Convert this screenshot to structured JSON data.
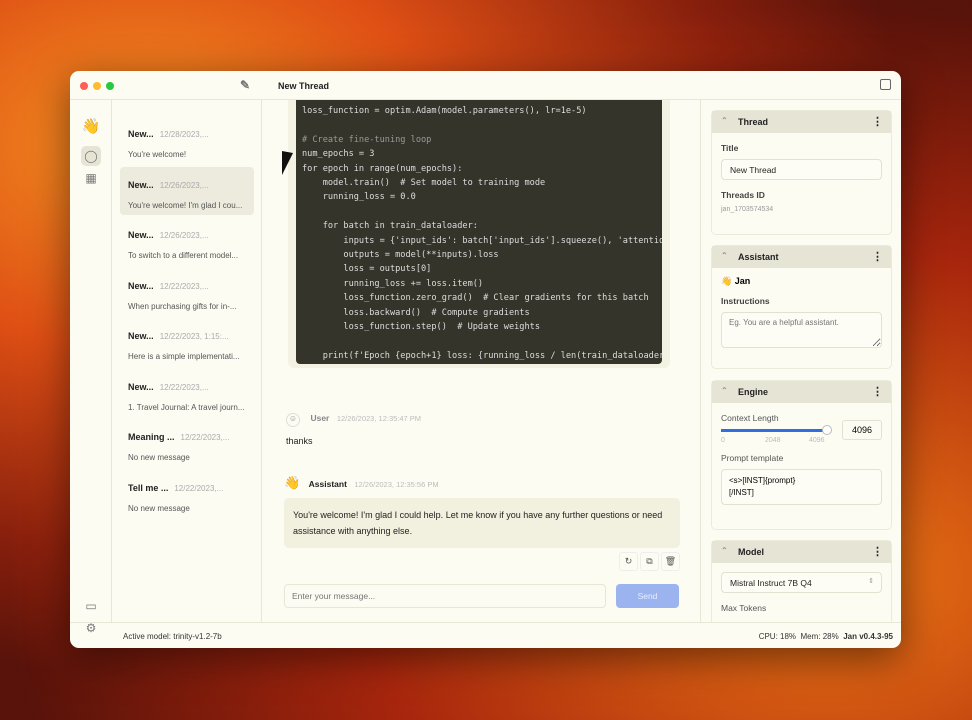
{
  "window": {
    "title": "New Thread"
  },
  "threads": [
    {
      "name": "New...",
      "date": "12/28/2023,...",
      "msg": "You're welcome!"
    },
    {
      "name": "New...",
      "date": "12/26/2023,...",
      "msg": "You're welcome! I'm glad I cou..."
    },
    {
      "name": "New...",
      "date": "12/26/2023,...",
      "msg": "To switch to a different model..."
    },
    {
      "name": "New...",
      "date": "12/22/2023,...",
      "msg": "When purchasing gifts for in-..."
    },
    {
      "name": "New...",
      "date": "12/22/2023, 1:15:...",
      "msg": "Here is a simple implementati..."
    },
    {
      "name": "New...",
      "date": "12/22/2023,...",
      "msg": "1. Travel Journal: A travel journ..."
    },
    {
      "name": "Meaning ...",
      "date": "12/22/2023,...",
      "msg": "No new message"
    },
    {
      "name": "Tell me ...",
      "date": "12/22/2023,...",
      "msg": "No new message"
    }
  ],
  "code": [
    "loss_function = optim.Adam(model.parameters(), lr=1e-5)",
    "",
    "# Create fine-tuning loop",
    "num_epochs = 3",
    "for epoch in range(num_epochs):",
    "    model.train()  # Set model to training mode",
    "    running_loss = 0.0",
    "",
    "    for batch in train_dataloader:",
    "        inputs = {'input_ids': batch['input_ids'].squeeze(), 'attention",
    "        outputs = model(**inputs).loss",
    "        loss = outputs[0]",
    "        running_loss += loss.item()",
    "        loss_function.zero_grad()  # Clear gradients for this batch",
    "        loss.backward()  # Compute gradients",
    "        loss_function.step()  # Update weights",
    "",
    "    print(f'Epoch {epoch+1} loss: {running_loss / len(train_dataloader"
  ],
  "messages": [
    {
      "author": "User",
      "time": "12/26/2023, 12:35:47 PM",
      "text": "thanks"
    },
    {
      "author": "Assistant",
      "time": "12/26/2023, 12:35:56 PM",
      "text": "You're welcome! I'm glad I could help. Let me know if you have any further questions or need assistance with anything else."
    }
  ],
  "composer": {
    "placeholder": "Enter your message...",
    "send": "Send"
  },
  "panel": {
    "thread": {
      "header": "Thread",
      "title_label": "Title",
      "title_value": "New Thread",
      "id_label": "Threads ID",
      "id_value": "jan_1703574534"
    },
    "assistant": {
      "header": "Assistant",
      "name": "Jan",
      "instructions_label": "Instructions",
      "instructions_placeholder": "Eg. You are a helpful assistant."
    },
    "engine": {
      "header": "Engine",
      "context_label": "Context Length",
      "context_value": "4096",
      "context_fraction": 1.0,
      "ticks": [
        "0",
        "2048",
        "4096"
      ],
      "prompt_label": "Prompt template",
      "prompt_value": "<s>[INST]{prompt}\n[/INST]"
    },
    "model": {
      "header": "Model",
      "selected": "Mistral Instruct 7B Q4",
      "max_tokens_label": "Max Tokens"
    }
  },
  "status": {
    "active_model": "Active model: trinity-v1.2-7b",
    "cpu": "CPU: 18%",
    "mem": "Mem: 28%",
    "version": "Jan v0.4.3-95"
  },
  "colors": {
    "accent": "#2f6de0",
    "send": "#9bb4f0"
  }
}
